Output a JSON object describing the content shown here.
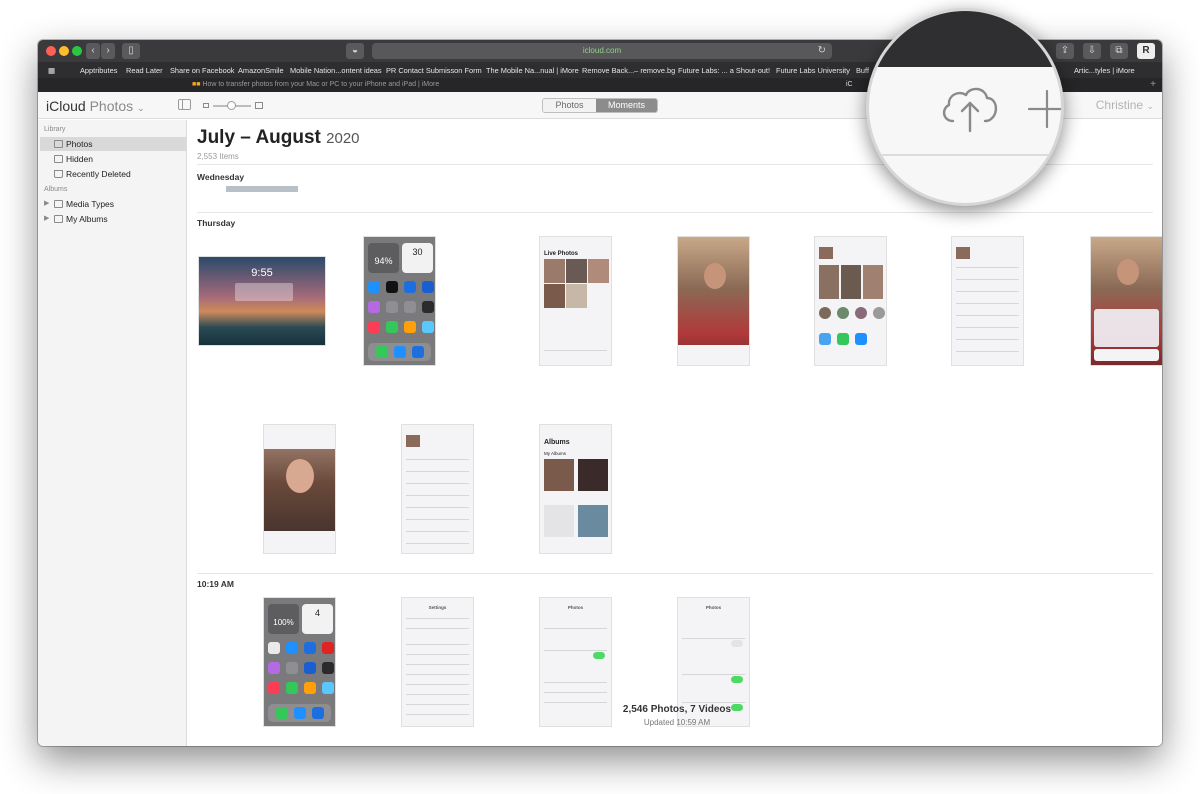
{
  "browser": {
    "url": "icloud.com",
    "tab_title": "How to transfer photos from your Mac or PC to your iPhone and iPad | iMore",
    "tab_icon": "iC",
    "bookmarks": [
      "Apptributes",
      "Read Later",
      "Share on Facebook",
      "AmazonSmile",
      "Mobile Nation...ontent ideas",
      "PR Contact Submisson Form",
      "The Mobile Na...nual | iMore",
      "Remove Back...– remove.bg",
      "Future Labs: ... a Shout-out!",
      "Future Labs University",
      "Buff",
      "Artic...tyles | iMore"
    ]
  },
  "app": {
    "brand": "iCloud",
    "brand_sub": "Photos",
    "view_tabs": [
      "Photos",
      "Moments"
    ],
    "active_tab": "Moments",
    "user": "Christine"
  },
  "sidebar": {
    "library_heading": "Library",
    "library_items": [
      "Photos",
      "Hidden",
      "Recently Deleted"
    ],
    "albums_heading": "Albums",
    "album_items": [
      "Media Types",
      "My Albums"
    ]
  },
  "content": {
    "title": "July – August",
    "year": "2020",
    "item_count": "2,553 Items",
    "sections": {
      "wednesday": "Wednesday",
      "thursday": "Thursday",
      "time": "10:19 AM"
    },
    "thumb_texts": {
      "lock_time": "9:55",
      "battery_94": "94%",
      "calendar_day": "30",
      "live_photos": "Live Photos",
      "albums": "Albums",
      "my_albums": "My Albums",
      "battery_100": "100%",
      "calendar_4": "4",
      "settings": "Settings",
      "photos": "Photos"
    },
    "footer_count": "2,546 Photos, 7 Videos",
    "footer_updated": "Updated 10:59 AM"
  },
  "colors": {
    "accent": "#8c8c8c",
    "toggle_green": "#4cd964"
  }
}
